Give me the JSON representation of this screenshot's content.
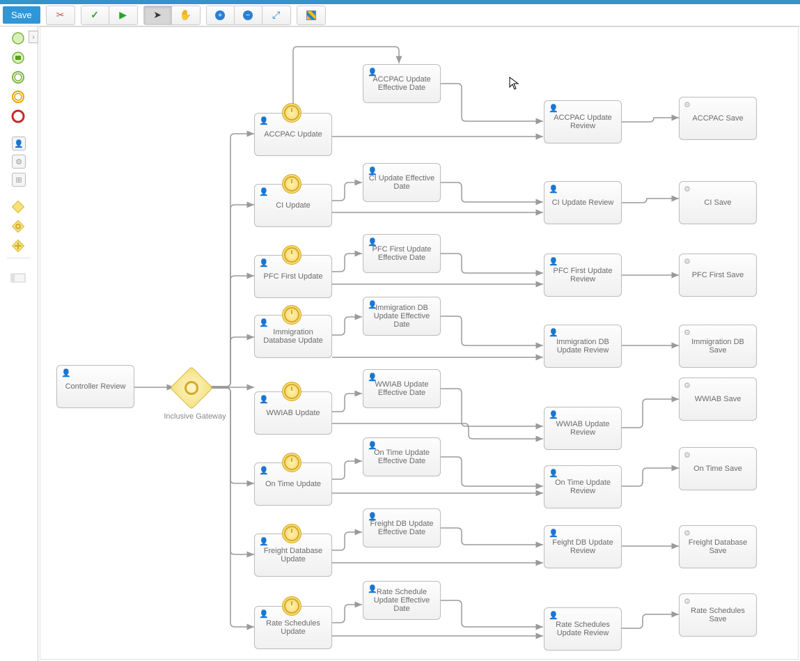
{
  "toolbar": {
    "save_label": "Save"
  },
  "gateway_label": "Inclusive Gateway",
  "tasks": {
    "controller_review": "Controller Review",
    "accpac_update": "ACCPAC Update",
    "accpac_eff": "ACCPAC Update Effective Date",
    "accpac_review": "ACCPAC Update Review",
    "accpac_save": "ACCPAC Save",
    "ci_update": "CI Update",
    "ci_eff": "CI Update Effective Date",
    "ci_review": "CI Update Review",
    "ci_save": "CI Save",
    "pfc_update": "PFC First Update",
    "pfc_eff": "PFC First Update Effective Date",
    "pfc_review": "PFC First Update Review",
    "pfc_save": "PFC First Save",
    "imm_update": "Immigration Database Update",
    "imm_eff": "Immigration DB Update Effective Date",
    "imm_review": "Immigration DB Update Review",
    "imm_save": "Immigration DB Save",
    "wwiab_update": "WWIAB Update",
    "wwiab_eff": "WWIAB Update Effective Date",
    "wwiab_review": "WWIAB Update Review",
    "wwiab_save": "WWIAB Save",
    "ontime_update": "On Time Update",
    "ontime_eff": "On Time Update Effective Date",
    "ontime_review": "On Time Update Review",
    "ontime_save": "On Time Save",
    "freight_update": "Freight Database Update",
    "freight_eff": "Freight DB Update Effective Date",
    "freight_review": "Feight DB Update Review",
    "freight_save": "Freight Database Save",
    "rate_update": "Rate Schedules Update",
    "rate_eff": "Rate Schedule Update Effective Date",
    "rate_review": "Rate Schedules Update Review",
    "rate_save": "Rate Schedules Save"
  }
}
